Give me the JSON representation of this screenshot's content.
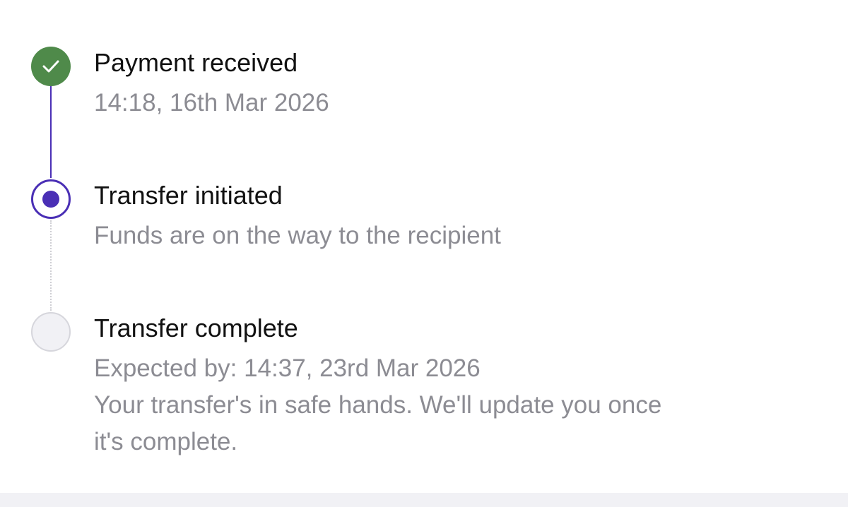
{
  "timeline": {
    "steps": [
      {
        "title": "Payment received",
        "subtitle": "14:18, 16th Mar 2026",
        "status": "complete",
        "icon": "check-icon"
      },
      {
        "title": "Transfer initiated",
        "subtitle": "Funds are on the way to the recipient",
        "status": "current",
        "icon": "current-dot-icon"
      },
      {
        "title": "Transfer complete",
        "subtitle": "Expected by: 14:37, 23rd Mar 2026",
        "note_line1": "Your transfer's in safe hands. We'll update you once",
        "note_line2": "it's complete.",
        "status": "pending",
        "icon": "pending-circle-icon"
      }
    ]
  },
  "colors": {
    "complete": "#4f8a4a",
    "accent": "#4a2fb5",
    "pending": "#f1f1f5",
    "title_text": "#111111",
    "secondary_text": "#8c8c93"
  }
}
